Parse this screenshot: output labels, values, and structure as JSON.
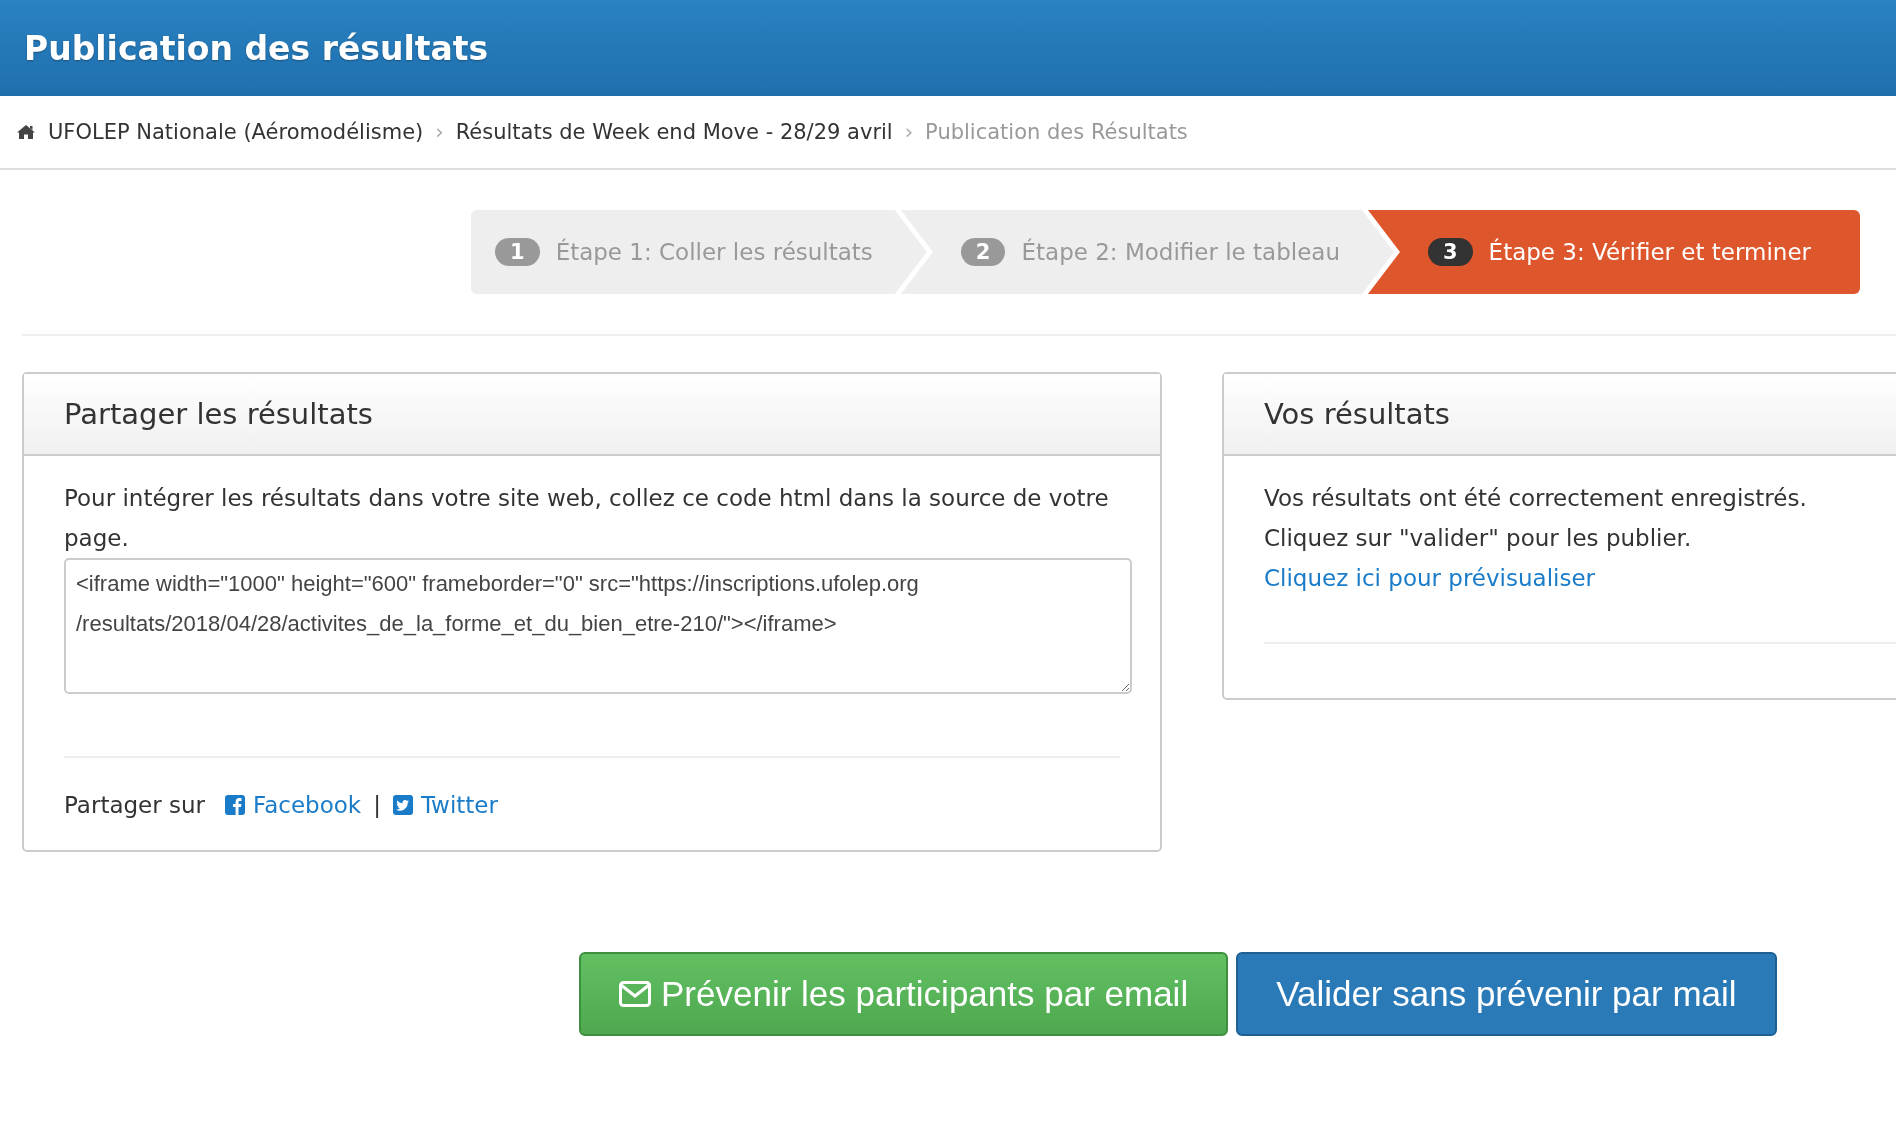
{
  "header": {
    "title": "Publication des résultats"
  },
  "breadcrumb": [
    {
      "label": "UFOLEP Nationale (Aéromodélisme)",
      "current": false
    },
    {
      "label": "Résultats de Week end Move - 28/29 avril",
      "current": false
    },
    {
      "label": "Publication des Résultats",
      "current": true
    }
  ],
  "separator": "›",
  "steps": [
    {
      "number": "1",
      "label": "Étape 1: Coller les résultats",
      "selected": false
    },
    {
      "number": "2",
      "label": "Étape 2: Modifier le tableau",
      "selected": false
    },
    {
      "number": "3",
      "label": "Étape 3: Vérifier et terminer",
      "selected": true
    }
  ],
  "share_panel": {
    "title": "Partager les résultats",
    "text": "Pour intégrer les résultats dans votre site web, collez ce code html dans la source de votre page.",
    "code": "<iframe width=\"1000\" height=\"600\" frameborder=\"0\" src=\"https://inscriptions.ufolep.org\n/resultats/2018/04/28/activites_de_la_forme_et_du_bien_etre-210/\"></iframe>",
    "share_label": "Partager sur",
    "links": [
      {
        "kind": "facebook",
        "label": "Facebook"
      },
      {
        "kind": "twitter",
        "label": "Twitter"
      }
    ],
    "link_separator": "|"
  },
  "results_panel": {
    "title": "Vos résultats",
    "lines": [
      "Vos résultats ont été correctement enregistrés.",
      "Cliquez sur \"valider\" pour les publier."
    ],
    "preview_link": "Cliquez ici pour prévisualiser"
  },
  "buttons": [
    {
      "kind": "success",
      "label": "Prévenir les participants par email"
    },
    {
      "kind": "primary",
      "label": "Valider sans prévenir par mail"
    }
  ]
}
